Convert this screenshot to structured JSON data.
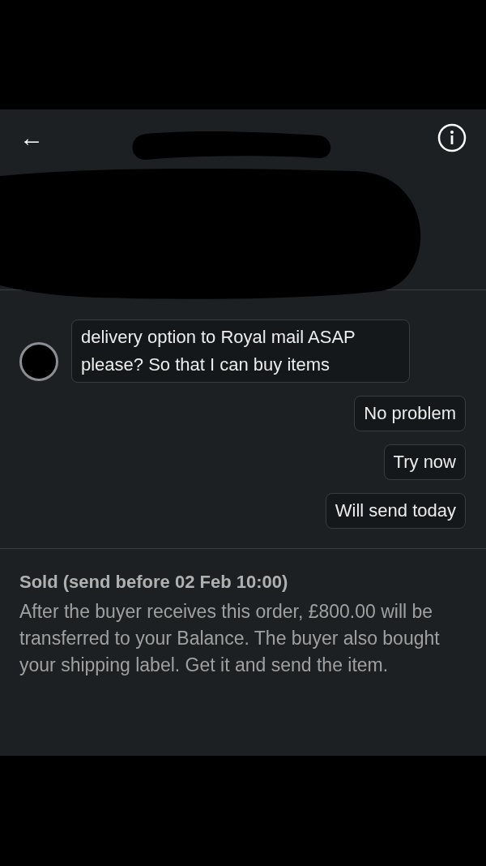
{
  "header": {
    "back": "←"
  },
  "messages": [
    {
      "kind": "received",
      "text": "delivery option to Royal mail ASAP please?  So that I can buy items"
    },
    {
      "kind": "sent",
      "text": "No problem"
    },
    {
      "kind": "sent",
      "text": "Try now"
    },
    {
      "kind": "sent",
      "text": "Will send today"
    }
  ],
  "order_status": {
    "title": "Sold (send before 02 Feb 10:00)",
    "description": "After the buyer receives this order, £800.00 will be transferred to your Balance. The buyer also bought your shipping label. Get it and send the item."
  }
}
